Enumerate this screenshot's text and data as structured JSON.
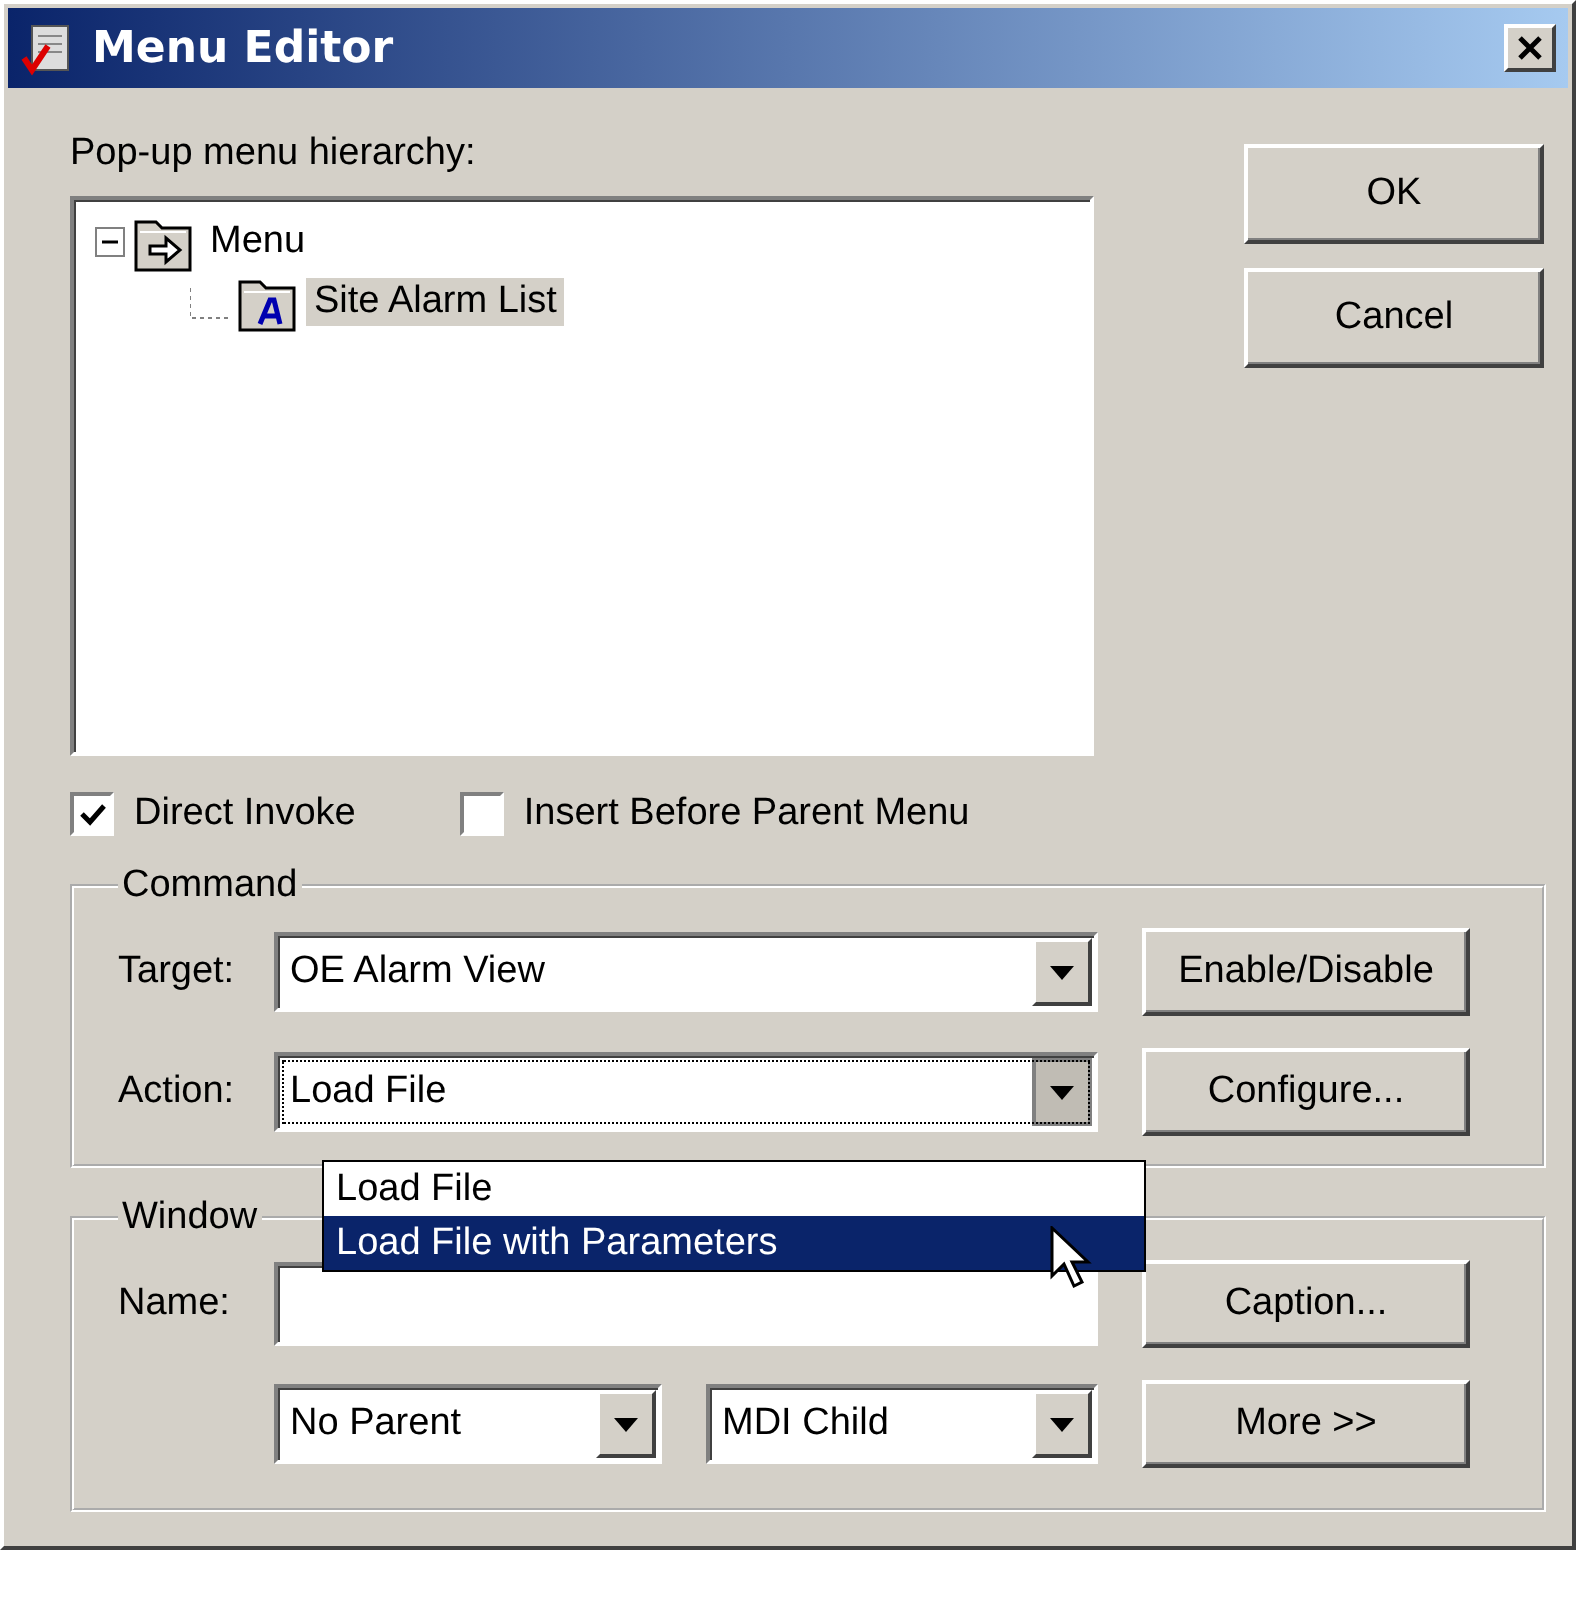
{
  "window": {
    "title": "Menu Editor"
  },
  "tree": {
    "label": "Pop-up menu hierarchy:",
    "items": [
      {
        "label": "Menu",
        "expanded": true,
        "selected": false,
        "children": [
          {
            "label": "Site Alarm List",
            "selected": true
          }
        ]
      }
    ]
  },
  "buttons": [
    "OK",
    "Cancel"
  ],
  "options": [
    {
      "label": "Direct Invoke",
      "checked": true
    },
    {
      "label": "Insert Before Parent Menu",
      "checked": false
    }
  ],
  "command": {
    "title": "Command",
    "target": {
      "label": "Target:",
      "value": "OE Alarm View"
    },
    "action": {
      "label": "Action:",
      "value": "Load File",
      "expanded": true,
      "options": [
        {
          "label": "Load File",
          "highlighted": false
        },
        {
          "label": "Load File with Parameters",
          "highlighted": true
        }
      ]
    },
    "buttons": [
      "Enable/Disable",
      "Configure..."
    ]
  },
  "window_group": {
    "title": "Window",
    "name": {
      "label": "Name:"
    },
    "parent": "No Parent",
    "type": "MDI Child",
    "buttons": [
      "Caption...",
      "More >>"
    ]
  }
}
